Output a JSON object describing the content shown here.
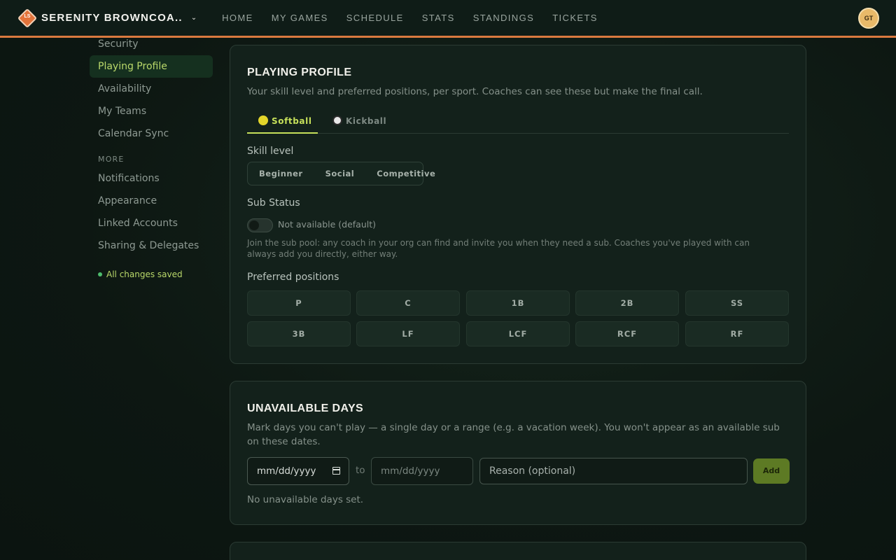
{
  "brand": {
    "logo_text": "LS",
    "name": "SERENITY BROWNCOA..",
    "caret": "⌄"
  },
  "nav": [
    "HOME",
    "MY GAMES",
    "SCHEDULE",
    "STATS",
    "STANDINGS",
    "TICKETS"
  ],
  "avatar": "GT",
  "sidebar": {
    "items_top": [
      {
        "label": "Security",
        "active": false
      },
      {
        "label": "Playing Profile",
        "active": true
      },
      {
        "label": "Availability",
        "active": false
      },
      {
        "label": "My Teams",
        "active": false
      },
      {
        "label": "Calendar Sync",
        "active": false
      }
    ],
    "section": "MORE",
    "items_more": [
      {
        "label": "Notifications"
      },
      {
        "label": "Appearance"
      },
      {
        "label": "Linked Accounts"
      },
      {
        "label": "Sharing & Delegates"
      }
    ],
    "saved": "All changes saved"
  },
  "profile": {
    "title": "PLAYING PROFILE",
    "desc": "Your skill level and preferred positions, per sport. Coaches can see these but make the final call.",
    "tabs": [
      {
        "label": "Softball",
        "icon": "softball-icon",
        "active": true
      },
      {
        "label": "Kickball",
        "icon": "kickball-icon",
        "active": false
      }
    ],
    "skill_label": "Skill level",
    "skill_options": [
      "Beginner",
      "Social",
      "Competitive"
    ],
    "sub_label": "Sub Status",
    "sub_toggle_on": false,
    "sub_toggle_text": "Not available (default)",
    "sub_help": "Join the sub pool: any coach in your org can find and invite you when they need a sub. Coaches you've played with can always add you directly, either way.",
    "positions_label": "Preferred positions",
    "positions": [
      "P",
      "C",
      "1B",
      "2B",
      "SS",
      "3B",
      "LF",
      "LCF",
      "RCF",
      "RF"
    ]
  },
  "unavailable": {
    "title": "UNAVAILABLE DAYS",
    "desc": "Mark days you can't play — a single day or a range (e.g. a vacation week). You won't appear as an available sub on these dates.",
    "from_placeholder": "mm/dd/yyyy",
    "to_label": "to",
    "to_placeholder": "mm/dd/yyyy",
    "reason_placeholder": "Reason (optional)",
    "add_label": "Add",
    "empty": "No unavailable days set."
  }
}
